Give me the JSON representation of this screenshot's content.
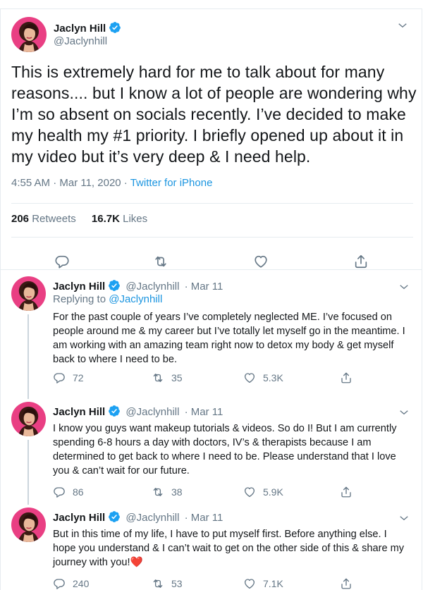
{
  "main": {
    "name": "Jaclyn Hill",
    "handle": "@Jaclynhill",
    "text": "This is extremely hard for me to talk about for many reasons.... but I know a lot of people are wondering why I’m so absent on socials recently. I’ve decided to make my health my #1 priority. I briefly opened up about it in my video but it’s very deep & I need help.",
    "time": "4:55 AM · Mar 11, 2020 · ",
    "source": "Twitter for iPhone",
    "retweets_count": "206",
    "retweets_label": "Retweets",
    "likes_count": "16.7K",
    "likes_label": "Likes"
  },
  "replies": [
    {
      "name": "Jaclyn Hill",
      "handle": "@Jaclynhill",
      "date": "· Mar 11",
      "replying_prefix": "Replying to ",
      "replying_to": "@Jaclynhill",
      "text": "For the past couple of years I’ve completely neglected ME. I’ve focused on people around me & my career but I’ve totally let myself go in the meantime. I am working with an amazing team right now to detox my body & get myself back to where I need to be.",
      "replies": "72",
      "retweets": "35",
      "likes": "5.3K"
    },
    {
      "name": "Jaclyn Hill",
      "handle": "@Jaclynhill",
      "date": "· Mar 11",
      "text": "I know you guys want makeup tutorials & videos. So do I! But I am currently spending 6-8 hours a day with doctors, IV’s & therapists because I am determined to get back to where I need to be. Please understand that I love you & can’t wait for our future.",
      "replies": "86",
      "retweets": "38",
      "likes": "5.9K"
    },
    {
      "name": "Jaclyn Hill",
      "handle": "@Jaclynhill",
      "date": "· Mar 11",
      "text": "But in this time of my life, I have to put myself first. Before anything else. I hope you understand & I can’t wait to get on the other side of this & share my journey with you!",
      "emoji": "❤️",
      "replies": "240",
      "retweets": "53",
      "likes": "7.1K"
    }
  ],
  "colors": {
    "accent": "#1b95e0",
    "verified": "#1da1f2",
    "secondary_text": "#657786",
    "heart": "#e0245e"
  },
  "icons": [
    "verified-badge-icon",
    "chevron-down-icon",
    "reply-icon",
    "retweet-icon",
    "like-icon",
    "share-icon"
  ]
}
